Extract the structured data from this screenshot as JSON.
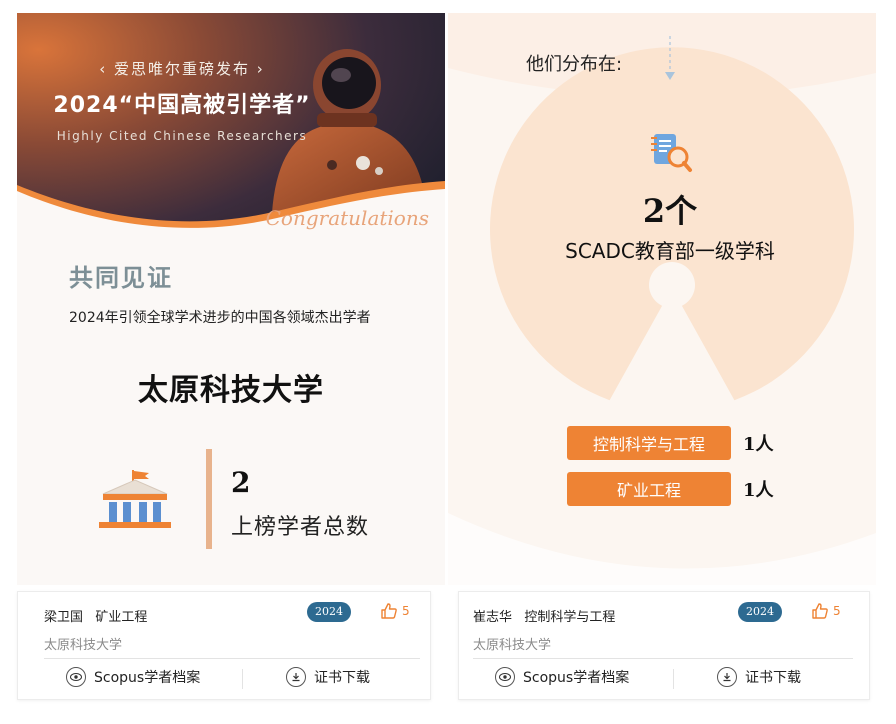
{
  "banner": {
    "pretitle": "‹ 爱思唯尔重磅发布 ›",
    "title": "2024“中国高被引学者”",
    "subtitle": "Highly Cited Chinese Researchers",
    "congrats": "Congratulations"
  },
  "witness": {
    "title": "共同见证",
    "subtitle": "2024年引领全球学术进步的中国各领域杰出学者"
  },
  "university": {
    "name": "太原科技大学",
    "count": "2",
    "count_label": "上榜学者总数"
  },
  "distribution": {
    "title": "他们分布在:",
    "subject_count": "2个",
    "subject_label": "SCADC教育部一级学科",
    "subjects": [
      {
        "name": "控制科学与工程",
        "people": "1人"
      },
      {
        "name": "矿业工程",
        "people": "1人"
      }
    ]
  },
  "cards": [
    {
      "name": "梁卫国",
      "subject": "矿业工程",
      "year": "2024",
      "likes": "5",
      "institution": "太原科技大学",
      "scopus_label": "Scopus学者档案",
      "download_label": "证书下载"
    },
    {
      "name": "崔志华",
      "subject": "控制科学与工程",
      "year": "2024",
      "likes": "5",
      "institution": "太原科技大学",
      "scopus_label": "Scopus学者档案",
      "download_label": "证书下载"
    }
  ],
  "colors": {
    "accent_orange": "#ee8334",
    "year_badge": "#2d6a91",
    "witness_title": "#7d8f96",
    "divider_tan": "#e8b38d"
  },
  "icons": [
    "museum-icon",
    "book-search-icon",
    "arrow-down-icon",
    "eye-icon",
    "download-icon",
    "thumbs-up-icon"
  ]
}
